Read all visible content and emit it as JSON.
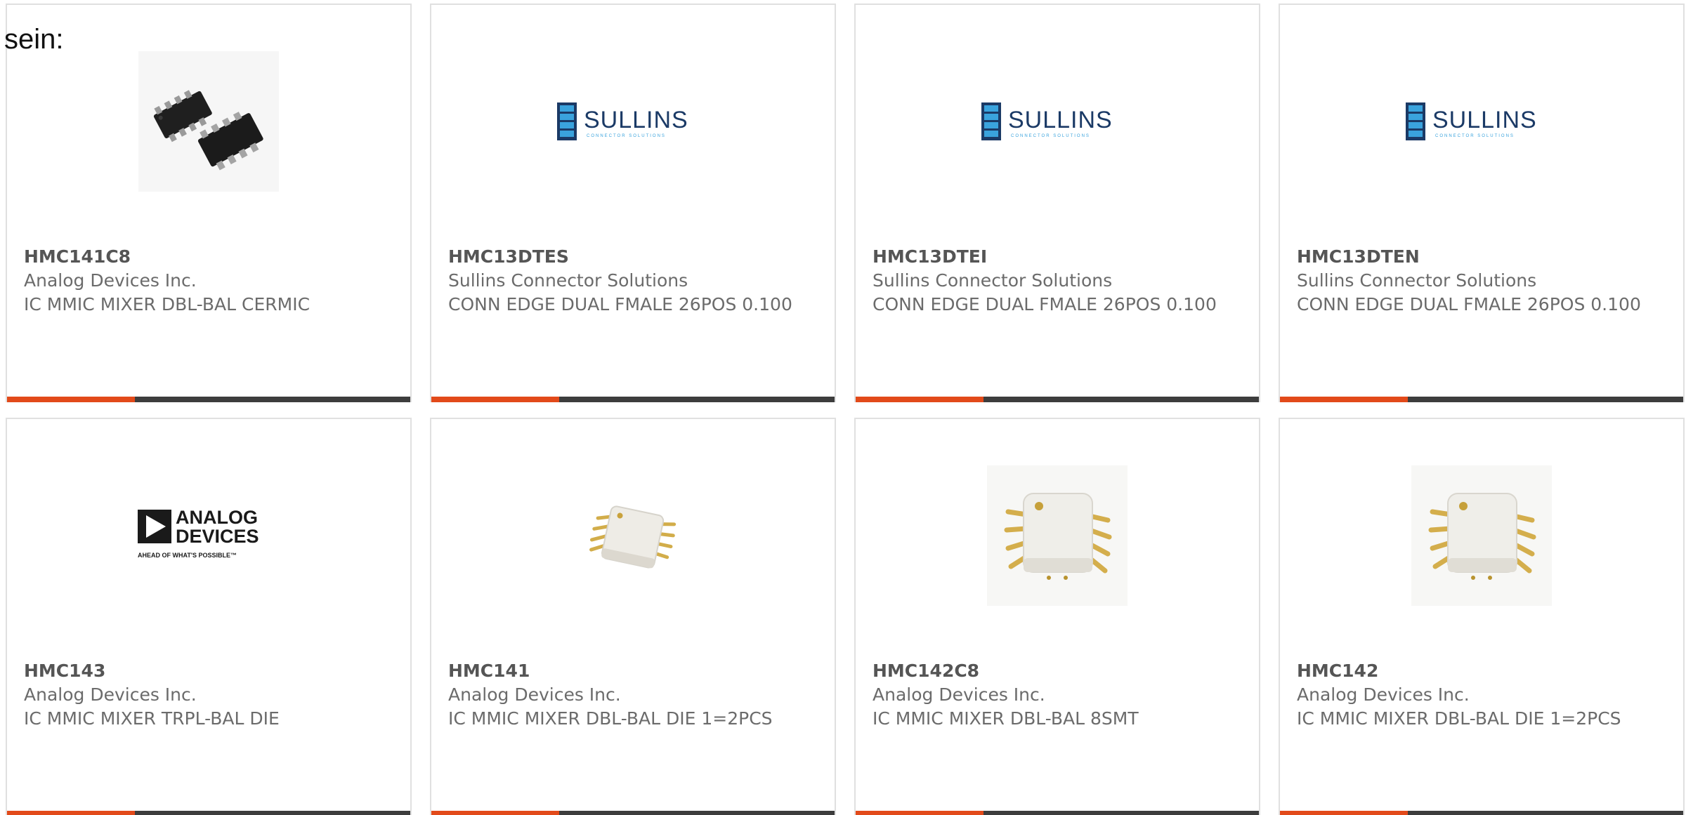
{
  "lead_text": "sein:",
  "colors": {
    "accent": "#e24a1a",
    "bar": "#3d3d3d",
    "border": "#e0e0e0",
    "text": "#6b6b6b"
  },
  "products": [
    {
      "part_number": "HMC141C8",
      "manufacturer": "Analog Devices Inc.",
      "description": "IC MMIC MIXER DBL-BAL CERMIC",
      "image": "soic-8-chip-photo"
    },
    {
      "part_number": "HMC13DTES",
      "manufacturer": "Sullins Connector Solutions",
      "description": "CONN EDGE DUAL FMALE 26POS 0.100",
      "image": "sullins-logo",
      "logo_text": "SULLINS",
      "logo_subtext": "CONNECTOR SOLUTIONS"
    },
    {
      "part_number": "HMC13DTEI",
      "manufacturer": "Sullins Connector Solutions",
      "description": "CONN EDGE DUAL FMALE 26POS 0.100",
      "image": "sullins-logo",
      "logo_text": "SULLINS",
      "logo_subtext": "CONNECTOR SOLUTIONS"
    },
    {
      "part_number": "HMC13DTEN",
      "manufacturer": "Sullins Connector Solutions",
      "description": "CONN EDGE DUAL FMALE 26POS 0.100",
      "image": "sullins-logo",
      "logo_text": "SULLINS",
      "logo_subtext": "CONNECTOR SOLUTIONS"
    },
    {
      "part_number": "HMC143",
      "manufacturer": "Analog Devices Inc.",
      "description": "IC MMIC MIXER TRPL-BAL DIE",
      "image": "analog-devices-logo",
      "logo_text_1": "ANALOG",
      "logo_text_2": "DEVICES",
      "logo_tagline": "AHEAD OF WHAT'S POSSIBLE™"
    },
    {
      "part_number": "HMC141",
      "manufacturer": "Analog Devices Inc.",
      "description": "IC MMIC MIXER DBL-BAL DIE 1=2PCS",
      "image": "smt-mixer-photo-small"
    },
    {
      "part_number": "HMC142C8",
      "manufacturer": "Analog Devices Inc.",
      "description": "IC MMIC MIXER DBL-BAL 8SMT",
      "image": "smt-mixer-photo-large"
    },
    {
      "part_number": "HMC142",
      "manufacturer": "Analog Devices Inc.",
      "description": "IC MMIC MIXER DBL-BAL DIE 1=2PCS",
      "image": "smt-mixer-photo-large"
    }
  ]
}
